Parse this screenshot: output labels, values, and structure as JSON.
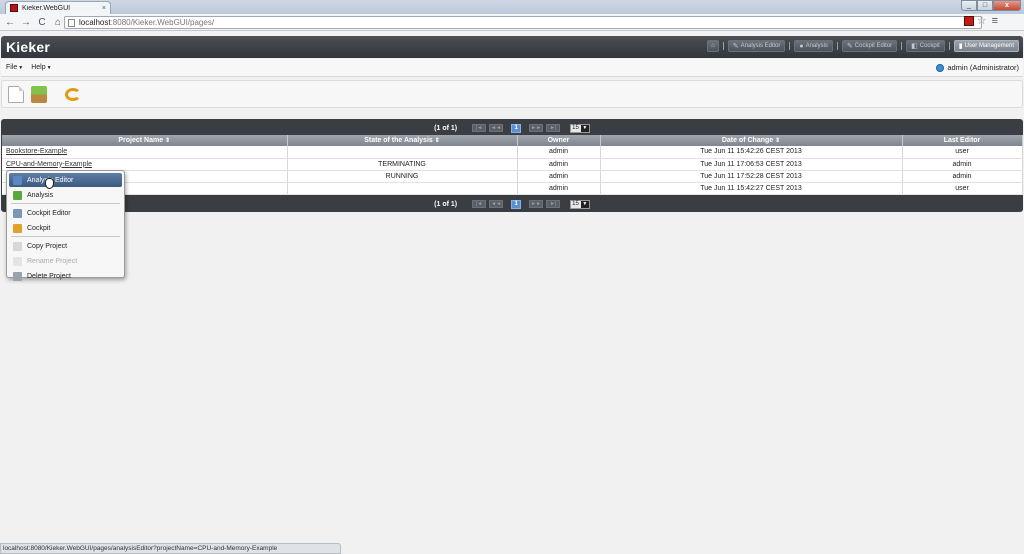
{
  "browser": {
    "tab_title": "Kieker.WebGUI",
    "tab_close": "×",
    "window_min": "_",
    "window_max": "□",
    "window_close": "x",
    "nav_back": "←",
    "nav_forward": "→",
    "nav_reload": "C",
    "nav_home": "⌂",
    "url_host": "localhost",
    "url_path": ":8080/Kieker.WebGUI/pages/",
    "star": "☆",
    "menu": "≡"
  },
  "app": {
    "logo": "Kieker",
    "nav": [
      {
        "label": "Analysis Editor",
        "icon": "✎"
      },
      {
        "label": "Analysis",
        "icon": "●"
      },
      {
        "label": "Cockpit Editor",
        "icon": "✎"
      },
      {
        "label": "Cockpit",
        "icon": "◧"
      },
      {
        "label": "User Management",
        "icon": "▮"
      }
    ],
    "menubar": {
      "file": "File",
      "help": "Help",
      "caret": "▼",
      "user": "admin (Administrator)"
    }
  },
  "table": {
    "pager": {
      "info": "(1 of 1)",
      "first": "|◄",
      "prev": "◄◄",
      "page": "1",
      "next": "►►",
      "last": "►|",
      "rows": "15",
      "rows_dd": "▼"
    },
    "sort_icon": "⇕",
    "columns": [
      "Project Name",
      "State of the Analysis",
      "Owner",
      "Date of Change",
      "Last Editor"
    ],
    "rows": [
      {
        "name": "Bookstore-Example",
        "state": "",
        "owner": "admin",
        "date": "Tue Jun 11 15:42:26 CEST 2013",
        "editor": "user"
      },
      {
        "name": "CPU-and-Memory-Example",
        "state": "TERMINATING",
        "owner": "admin",
        "date": "Tue Jun 11 17:06:53 CEST 2013",
        "editor": "admin"
      },
      {
        "name": "",
        "state": "RUNNING",
        "owner": "admin",
        "date": "Tue Jun 11 17:52:28 CEST 2013",
        "editor": "admin"
      },
      {
        "name": "",
        "state": "",
        "owner": "admin",
        "date": "Tue Jun 11 15:42:27 CEST 2013",
        "editor": "user"
      }
    ]
  },
  "context_menu": {
    "items": [
      {
        "label": "Analysis Editor",
        "color": "#5d87c2"
      },
      {
        "label": "Analysis",
        "color": "#5aa83c"
      },
      {
        "label": "Cockpit Editor",
        "color": "#7a96b8"
      },
      {
        "label": "Cockpit",
        "color": "#e0a22a"
      },
      {
        "label": "Copy Project",
        "color": "#d8d8d8"
      },
      {
        "label": "Rename Project",
        "color": "#e4e4e4"
      },
      {
        "label": "Delete Project",
        "color": "#9aa3ad"
      }
    ]
  },
  "status": "localhost:8080/Kieker.WebGUI/pages/analysisEditor?projectName=CPU-and-Memory-Example"
}
